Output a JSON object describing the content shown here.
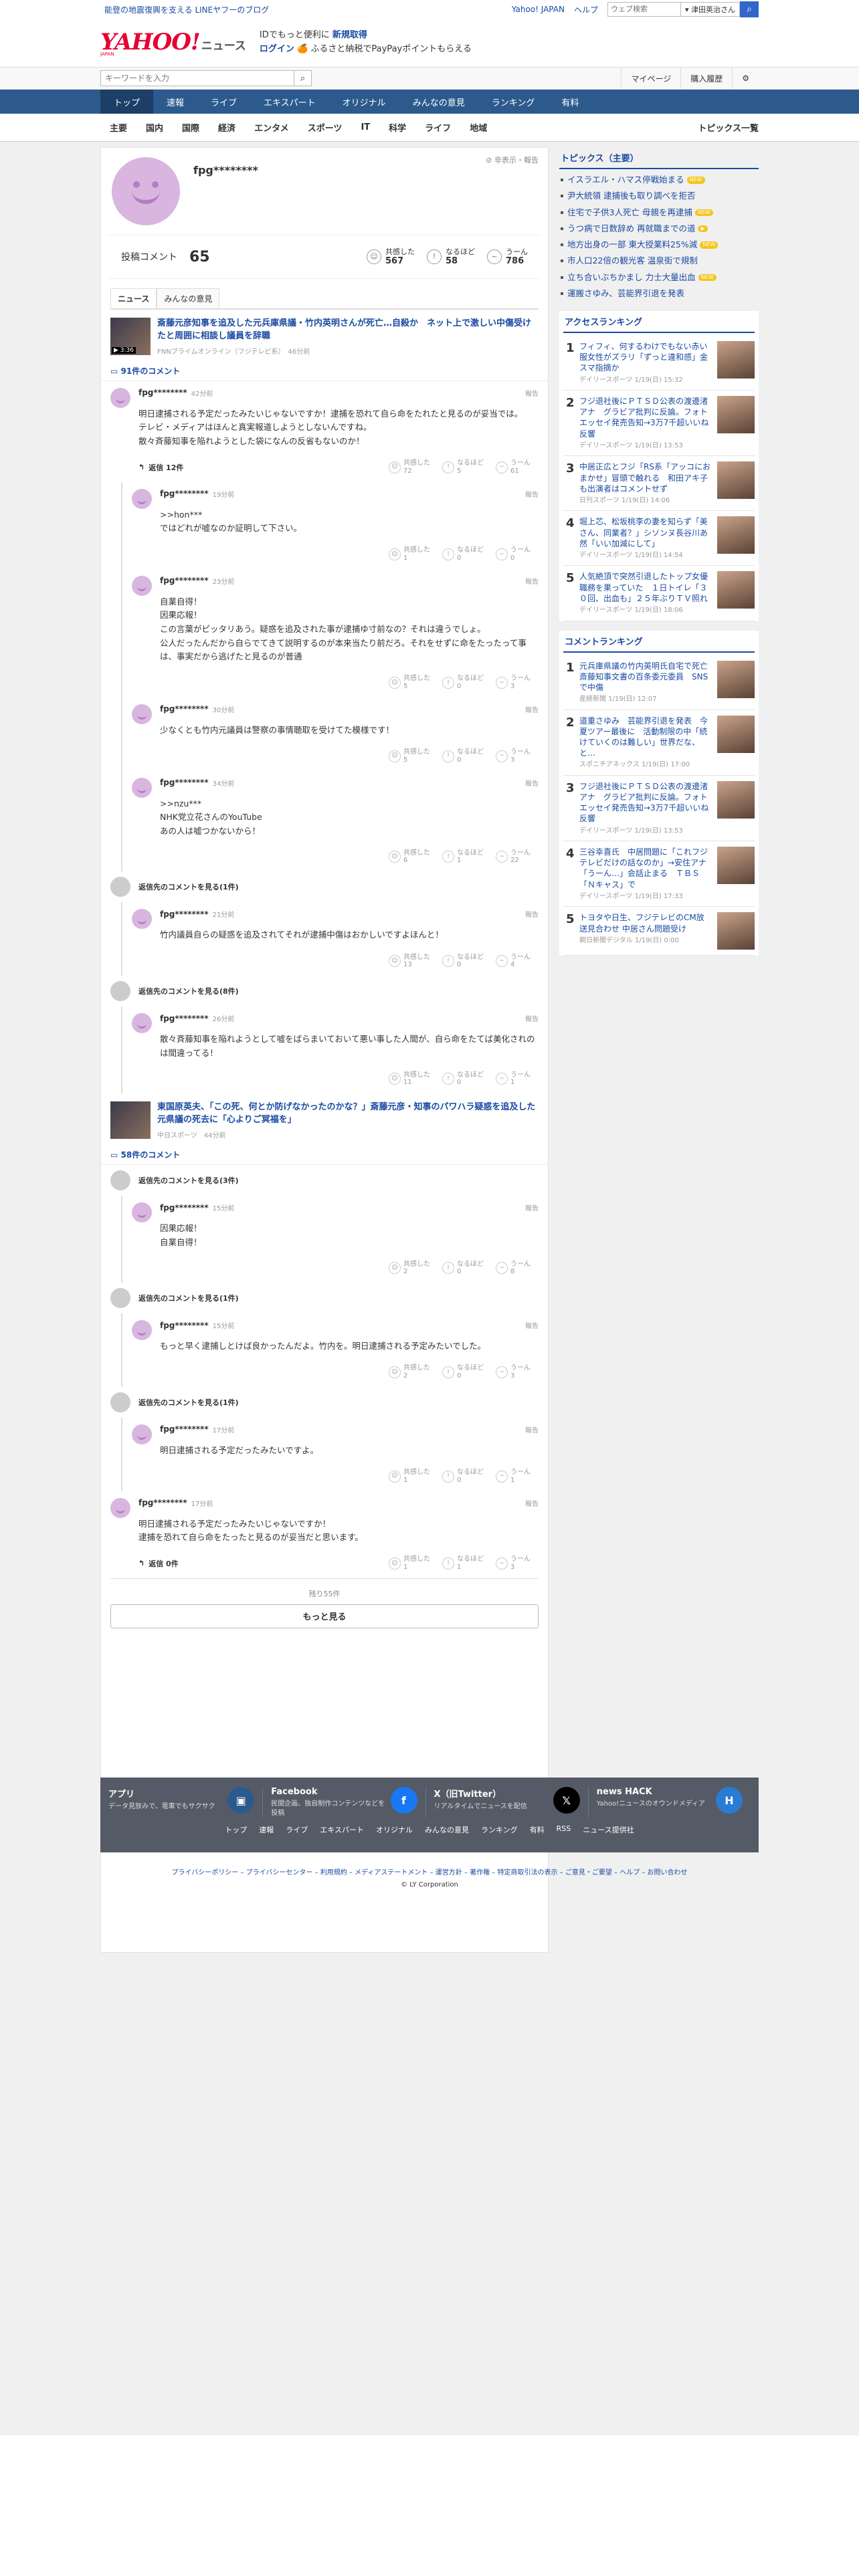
{
  "notice": {
    "text": "能登の地震復興を支える LINEヤフーのブログ"
  },
  "toplinks": {
    "yj": "Yahoo! JAPAN",
    "help": "ヘルプ",
    "web_placeholder": "ウェブ検索",
    "scope": "▾ 津田英治さん",
    "search_icon": "search-icon"
  },
  "header": {
    "logo": "YAHOO!",
    "logo_sub": "JAPAN",
    "brand": "ニュース",
    "promo1": "IDでもっと便利に",
    "promo1b": "新規取得",
    "login": "ログイン",
    "promo2": "🍊 ふるさと納税でPayPayポイントもらえる"
  },
  "searchbar": {
    "placeholder": "キーワードを入力",
    "mypage": "マイページ",
    "history": "購入履歴",
    "gear": "gear-icon"
  },
  "nav": [
    "トップ",
    "速報",
    "ライブ",
    "エキスパート",
    "オリジナル",
    "みんなの意見",
    "ランキング",
    "有料"
  ],
  "subnav": [
    "主要",
    "国内",
    "国際",
    "経済",
    "エンタメ",
    "スポーツ",
    "IT",
    "科学",
    "ライフ",
    "地域"
  ],
  "subnav_right": "トピックス一覧",
  "profile": {
    "name": "fpg********",
    "report": "非表示・報告",
    "posts_label": "投稿コメント",
    "posts": "65",
    "reactions": [
      {
        "label": "共感した",
        "n": "567",
        "icon": "☺"
      },
      {
        "label": "なるほど",
        "n": "58",
        "icon": "!"
      },
      {
        "label": "うーん",
        "n": "786",
        "icon": "~"
      }
    ]
  },
  "tabs": [
    "ニュース",
    "みんなの意見"
  ],
  "articles": [
    {
      "title": "斎藤元彦知事を追及した元兵庫県議・竹内英明さんが死亡…自殺か　ネット上で激しい中傷受けたと周囲に相談し議員を辞職",
      "meta": "FNNプライムオンライン（フジテレビ系）　46分前",
      "duration": "▶ 3:36",
      "count": "91件のコメント",
      "comments": [
        {
          "type": "c",
          "name": "fpg********",
          "time": "42分前",
          "text": "明日逮捕される予定だったみたいじゃないですか！逮捕を恐れて自ら命をたれたと見るのが妥当では。\nテレビ・メディアはほんと真実報道しようとしないんですね。\n散々斉藤知事を陥れようとした袋になんの反省もないのか！",
          "reply": "返信 12件",
          "r": [
            "72",
            "5",
            "61"
          ]
        },
        {
          "type": "s",
          "name": "fpg********",
          "time": "19分前",
          "text": ">>hon***\nではどれが嘘なのか証明して下さい。",
          "r": [
            "1",
            "0",
            "0"
          ]
        },
        {
          "type": "s",
          "name": "fpg********",
          "time": "23分前",
          "text": "自業自得！\n因果応報！\nこの言葉がピッタリあう。疑惑を追及された事が逮捕ゆ寸前なの？それは違うでしょ。\n公人だったんだから自らでてきて説明するのが本来当たり前だろ。それをせずに命をたったって事は、事実だから逃げたと見るのが普通",
          "r": [
            "5",
            "0",
            "3"
          ]
        },
        {
          "type": "s",
          "name": "fpg********",
          "time": "30分前",
          "text": "少なくとも竹内元議員は警察の事情聴取を受けてた模様です！",
          "r": [
            "5",
            "0",
            "3"
          ]
        },
        {
          "type": "s",
          "name": "fpg********",
          "time": "34分前",
          "text": ">>nzu***\nNHK党立花さんのYouTube\nあの人は嘘つかないから！",
          "r": [
            "6",
            "1",
            "22"
          ]
        },
        {
          "type": "h",
          "text": "返信先のコメントを見る(1件)"
        },
        {
          "type": "s",
          "name": "fpg********",
          "time": "21分前",
          "text": "竹内議員自らの疑惑を追及されてそれが逮捕中傷はおかしいですよほんと！",
          "r": [
            "13",
            "0",
            "4"
          ]
        },
        {
          "type": "h",
          "text": "返信先のコメントを見る(8件)"
        },
        {
          "type": "s",
          "name": "fpg********",
          "time": "26分前",
          "text": "散々斉藤知事を陥れようとして嘘をばらまいておいて悪い事した人間が、自ら命をたてば美化されのは間違ってる！",
          "r": [
            "11",
            "0",
            "1"
          ]
        }
      ]
    },
    {
      "title": "東国原英夫、「この死、何とか防げなかったのかな？」斎藤元彦・知事のパワハラ疑惑を追及した元県議の死去に「心よりご冥福を」",
      "meta": "中日スポーツ　44分前",
      "count": "58件のコメント",
      "comments": [
        {
          "type": "h",
          "text": "返信先のコメントを見る(3件)"
        },
        {
          "type": "s",
          "name": "fpg********",
          "time": "15分前",
          "text": "因果応報！\n自業自得！",
          "r": [
            "2",
            "0",
            "8"
          ]
        },
        {
          "type": "h",
          "text": "返信先のコメントを見る(1件)"
        },
        {
          "type": "s",
          "name": "fpg********",
          "time": "15分前",
          "text": "もっと早く逮捕しとけば良かったんだよ。竹内を。明日逮捕される予定みたいでした。",
          "r": [
            "2",
            "0",
            "3"
          ]
        },
        {
          "type": "h",
          "text": "返信先のコメントを見る(1件)"
        },
        {
          "type": "s",
          "name": "fpg********",
          "time": "17分前",
          "text": "明日逮捕される予定だったみたいですよ。",
          "r": [
            "1",
            "0",
            "1"
          ]
        },
        {
          "type": "c",
          "name": "fpg********",
          "time": "17分前",
          "text": "明日逮捕される予定だったみたいじゃないですか！\n逮捕を恐れて自ら命をたったと見るのが妥当だと思います。",
          "reply": "返信 0件",
          "r": [
            "1",
            "1",
            "3"
          ]
        }
      ]
    }
  ],
  "more": {
    "left": "残り55件",
    "button": "もっと見る"
  },
  "sidebar": {
    "topics_title": "トピックス（主要）",
    "topics": [
      {
        "t": "イスラエル・ハマス停戦始まる",
        "n": "NEW"
      },
      {
        "t": "尹大統領 逮捕後も取り調べを拒否"
      },
      {
        "t": "住宅で子供3人死亡 母親を再逮捕",
        "n": "NEW"
      },
      {
        "t": "うつ病で日数辞め 再就職までの道",
        "n": "▶"
      },
      {
        "t": "地方出身の一部 東大授業料25%減",
        "n": "NEW"
      },
      {
        "t": "市人口22倍の観光客 温泉街で規制"
      },
      {
        "t": "立ち合いぶちかまし 力士大量出血",
        "n": "NEW"
      },
      {
        "t": "運搬さゆみ、芸能界引退を発表"
      }
    ],
    "access_title": "アクセスランキング",
    "access": [
      {
        "t": "フィフィ、何するわけでもない赤い服女性がズラリ「ずっと違和感」金スマ指摘か",
        "m": "デイリースポーツ 1/19(日) 15:32"
      },
      {
        "t": "フジ退社後にＰＴＳＤ公表の渡邊渚アナ　グラビア批判に反論。フォトエッセイ発売告知→3万7千超いいね反響",
        "m": "デイリースポーツ 1/19(日) 13:53"
      },
      {
        "t": "中居正広とフジ「RS系「アッコにおまかせ」冒頭で触れる　和田アキ子も出演者はコメントせず",
        "m": "日刊スポーツ 1/19(日) 14:06"
      },
      {
        "t": "堀上芯、松坂桃李の妻を知らず「美さん、同業者？」シソンヌ長谷川あ然「いい加減にして」",
        "m": "デイリースポーツ 1/19(日) 14:54"
      },
      {
        "t": "人気絶頂で突然引退したトップ女優　職務を果っていた　１日トイレ「３０回、出血も」２５年ぶりＴＶ照れ",
        "m": "デイリースポーツ 1/19(日) 18:06"
      }
    ],
    "comment_title": "コメントランキング",
    "comment": [
      {
        "t": "元兵庫県議の竹内英明氏自宅で死亡　斎藤知事文書の百条委元委員　SNSで中傷",
        "m": "産経新聞 1/19(日) 12:07"
      },
      {
        "t": "道重さゆみ　芸能界引退を発表　今夏ツアー最後に　活動制限の中「続けていくのは難しい」世界だな、と…",
        "m": "スポニチアネックス 1/19(日) 17:00"
      },
      {
        "t": "フジ退社後にＰＴＳＤ公表の渡邊渚アナ　グラビア批判に反論。フォトエッセイ発売告知→3万7千超いいね反響",
        "m": "デイリースポーツ 1/19(日) 13:53"
      },
      {
        "t": "三谷幸喜氏　中居問題に「これフジテレビだけの話なのか」→安住アナ「うーん…」会話止まる　ＴＢＳ「Ｎキャス」で",
        "m": "デイリースポーツ 1/19(日) 17:33"
      },
      {
        "t": "トヨタや日生、フジテレビのCM放送見合わせ 中居さん問題受け",
        "m": "朝日新聞デジタル 1/19(日) 0:00"
      }
    ]
  },
  "footer": {
    "cols": [
      {
        "t": "アプリ",
        "d": "データ見放みで、電車でもサクサク",
        "icon": "app-icon",
        "glyph": "▣",
        "color": "#2c5a8d"
      },
      {
        "t": "Facebook",
        "d": "民間企画、独自制作コンテンツなどを投稿",
        "icon": "facebook-icon",
        "glyph": "f",
        "color": "#1877f2"
      },
      {
        "t": "X（旧Twitter）",
        "d": "リアルタイムでニュースを配信",
        "icon": "x-icon",
        "glyph": "𝕏",
        "color": "#000"
      },
      {
        "t": "news HACK",
        "d": "Yahoo!ニュースのオウンドメディア",
        "icon": "newshack-icon",
        "glyph": "H",
        "color": "#2a7bd4"
      }
    ],
    "links": [
      "トップ",
      "速報",
      "ライブ",
      "エキスパート",
      "オリジナル",
      "みんなの意見",
      "ランキング",
      "有料",
      "RSS",
      "ニュース提供社"
    ],
    "legal": "プライバシーポリシー – プライバシーセンター – 利用規約 – メディアステートメント – 運営方針 – 著作権 – 特定商取引法の表示 – ご意見・ご要望 – ヘルプ – お問い合わせ",
    "copy": "© LY Corporation"
  }
}
